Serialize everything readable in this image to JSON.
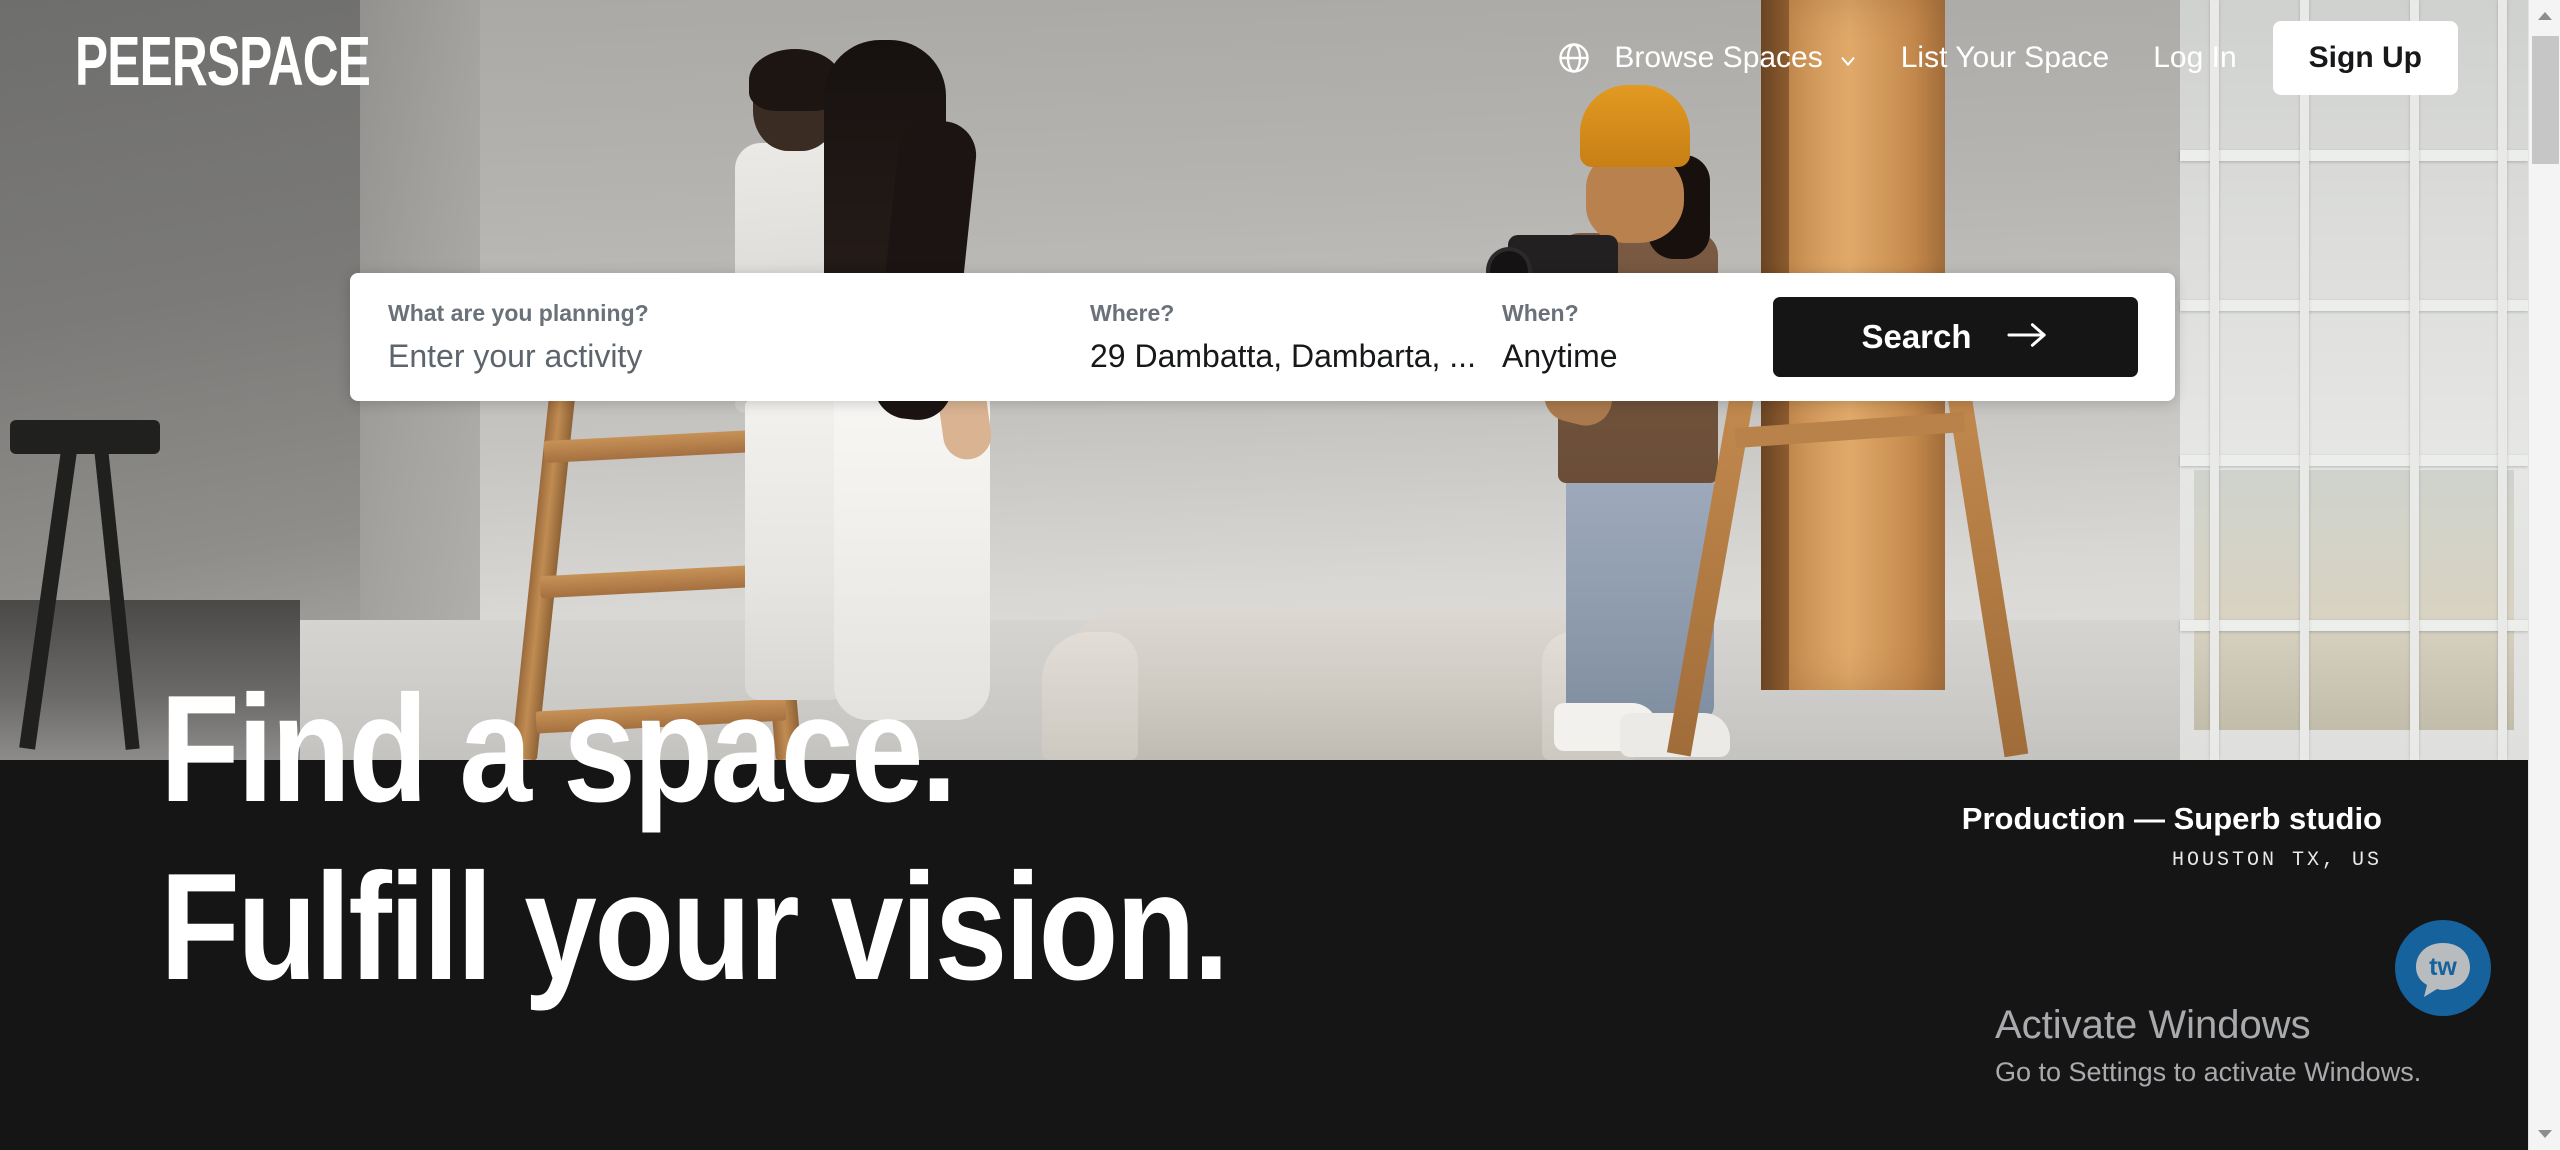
{
  "brand": {
    "logo_text": "PEERSPACE"
  },
  "nav": {
    "globe_icon": "globe-icon",
    "items": [
      {
        "label": "Browse Spaces",
        "icon": "chevron-down-icon"
      },
      {
        "label": "List Your Space"
      },
      {
        "label": "Log In"
      }
    ],
    "signup_label": "Sign Up"
  },
  "search": {
    "activity": {
      "label": "What are you planning?",
      "placeholder": "Enter your activity",
      "value": ""
    },
    "where": {
      "label": "Where?",
      "value": "29 Dambatta, Dambarta, ..."
    },
    "when": {
      "label": "When?",
      "value": "Anytime"
    },
    "button_label": "Search",
    "button_icon": "arrow-right-icon"
  },
  "hero": {
    "headline_line1": "Find a space.",
    "headline_line2": "Fulfill your vision."
  },
  "photo_credit": {
    "title": "Production — Superb studio",
    "location": "HOUSTON TX, US"
  },
  "chat_widget": {
    "label": "tw",
    "icon": "chat-bubble-icon",
    "color": "#15629c"
  },
  "watermark": {
    "line1": "Activate Windows",
    "line2": "Go to Settings to activate Windows."
  },
  "scrollbar": {
    "up_icon": "scroll-up-arrow-icon",
    "down_icon": "scroll-down-arrow-icon"
  },
  "colors": {
    "dark": "#151515",
    "accent_white": "#ffffff",
    "chat_blue": "#15629c"
  }
}
